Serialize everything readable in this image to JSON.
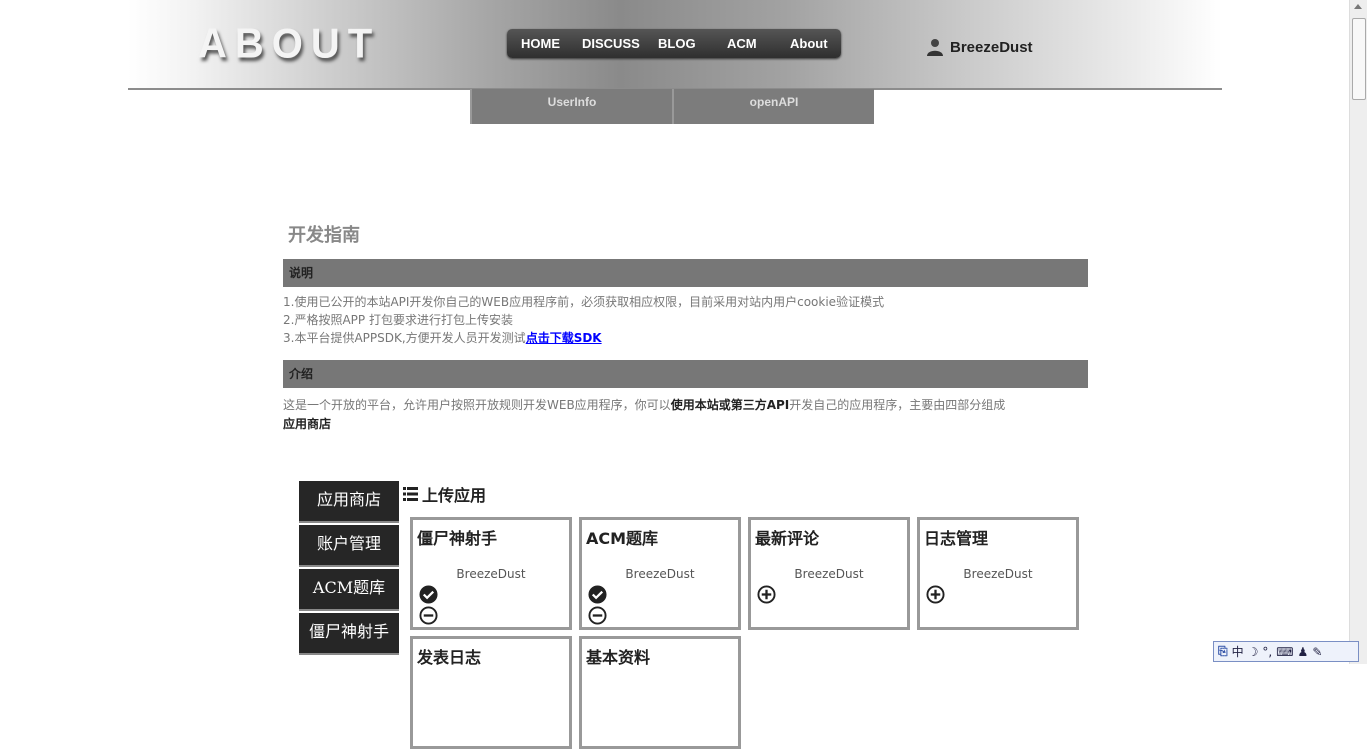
{
  "header": {
    "logo": "ABOUT",
    "nav": [
      "HOME",
      "DISCUSS",
      "BLOG",
      "ACM",
      "About"
    ],
    "user": "BreezeDust"
  },
  "subnav": [
    "UserInfo",
    "openAPI"
  ],
  "guide": {
    "title": "开发指南",
    "desc_header": "说明",
    "desc_lines": [
      "1.使用已公开的本站API开发你自己的WEB应用程序前，必须获取相应权限，目前采用对站内用户cookie验证模式",
      "2.严格按照APP 打包要求进行打包上传安装",
      "3.本平台提供APPSDK,方便开发人员开发测试"
    ],
    "sdk_link": "点击下载SDK",
    "intro_header": "介绍",
    "intro_pre": "这是一个开放的平台，允许用户按照开放规则开发WEB应用程序，你可以",
    "intro_bold": "使用本站或第三方API",
    "intro_post": "开发自己的应用程序，主要由四部分组成",
    "intro_sub": "应用商店"
  },
  "sidemenu": [
    "应用商店",
    "账户管理",
    "ACM题库",
    "僵尸神射手"
  ],
  "upload_title": "上传应用",
  "cards": [
    {
      "title": "僵尸神射手",
      "author": "BreezeDust",
      "icons": [
        "check-circle-icon",
        "minus-circle-icon"
      ]
    },
    {
      "title": "ACM题库",
      "author": "BreezeDust",
      "icons": [
        "check-circle-icon",
        "minus-circle-icon"
      ]
    },
    {
      "title": "最新评论",
      "author": "BreezeDust",
      "icons": [
        "plus-circle-icon"
      ]
    },
    {
      "title": "日志管理",
      "author": "BreezeDust",
      "icons": [
        "plus-circle-icon"
      ]
    },
    {
      "title": "发表日志",
      "author": "",
      "icons": []
    },
    {
      "title": "基本资料",
      "author": "",
      "icons": []
    }
  ],
  "ime": {
    "chinese": "中",
    "punct": "°,"
  },
  "colors": {
    "bar": "#777777",
    "card_border": "#999999",
    "side_menu": "#262626",
    "link": "#0000ff"
  }
}
